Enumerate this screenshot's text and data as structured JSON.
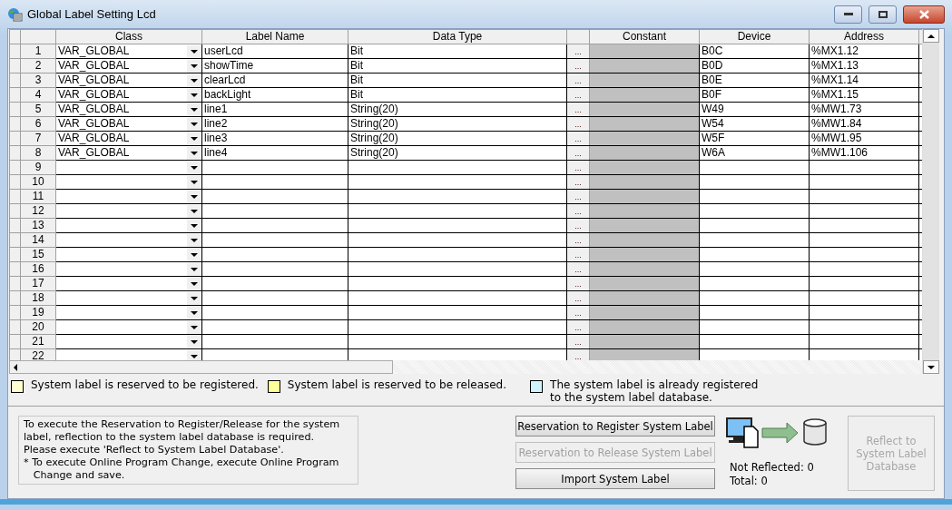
{
  "window": {
    "title": "Global Label Setting Lcd"
  },
  "table": {
    "columns": [
      "Class",
      "Label Name",
      "Data Type",
      "Constant",
      "Device",
      "Address"
    ],
    "rows": [
      {
        "number": "1",
        "class": "VAR_GLOBAL",
        "label_name": "userLcd",
        "data_type": "Bit",
        "browse": "...",
        "device": "B0C",
        "address": "%MX1.12"
      },
      {
        "number": "2",
        "class": "VAR_GLOBAL",
        "label_name": "showTime",
        "data_type": "Bit",
        "browse": "...",
        "device": "B0D",
        "address": "%MX1.13"
      },
      {
        "number": "3",
        "class": "VAR_GLOBAL",
        "label_name": "clearLcd",
        "data_type": "Bit",
        "browse": "...",
        "device": "B0E",
        "address": "%MX1.14"
      },
      {
        "number": "4",
        "class": "VAR_GLOBAL",
        "label_name": "backLight",
        "data_type": "Bit",
        "browse": "...",
        "device": "B0F",
        "address": "%MX1.15"
      },
      {
        "number": "5",
        "class": "VAR_GLOBAL",
        "label_name": "line1",
        "data_type": "String(20)",
        "browse": "...",
        "device": "W49",
        "address": "%MW1.73"
      },
      {
        "number": "6",
        "class": "VAR_GLOBAL",
        "label_name": "line2",
        "data_type": "String(20)",
        "browse": "...",
        "device": "W54",
        "address": "%MW1.84"
      },
      {
        "number": "7",
        "class": "VAR_GLOBAL",
        "label_name": "line3",
        "data_type": "String(20)",
        "browse": "...",
        "device": "W5F",
        "address": "%MW1.95"
      },
      {
        "number": "8",
        "class": "VAR_GLOBAL",
        "label_name": "line4",
        "data_type": "String(20)",
        "browse": "...",
        "device": "W6A",
        "address": "%MW1.106"
      },
      {
        "number": "9",
        "browse": "..."
      },
      {
        "number": "10",
        "browse": "..."
      },
      {
        "number": "11",
        "browse": "..."
      },
      {
        "number": "12",
        "browse": "..."
      },
      {
        "number": "13",
        "browse": "..."
      },
      {
        "number": "14",
        "browse": "..."
      },
      {
        "number": "15",
        "browse": "..."
      },
      {
        "number": "16",
        "browse": "..."
      },
      {
        "number": "17",
        "browse": "..."
      },
      {
        "number": "18",
        "browse": "..."
      },
      {
        "number": "19",
        "browse": "..."
      },
      {
        "number": "20",
        "browse": "..."
      },
      {
        "number": "21",
        "browse": "..."
      },
      {
        "number": "22",
        "browse": "..."
      }
    ]
  },
  "legend": [
    {
      "color": "#ffffd0",
      "text": "System label is reserved to be registered."
    },
    {
      "color": "#ffff99",
      "text": "System label is reserved to be released."
    },
    {
      "color": "#d0f4ff",
      "text": "The system label is already registered\nto the system label database."
    }
  ],
  "info_text": "To execute the Reservation to Register/Release for the system\nlabel, reflection to the system label database is required.\nPlease execute 'Reflect to System Label Database'.\n* To execute Online Program Change, execute Online Program\n   Change and save.",
  "buttons": [
    {
      "label": "Reservation to Register System Label",
      "disabled": false
    },
    {
      "label": "Reservation to Release System Label",
      "disabled": true
    },
    {
      "label": "Import System Label",
      "disabled": false
    }
  ],
  "status": {
    "not_reflected": "Not Reflected: 0",
    "total": "Total: 0"
  },
  "reflect_button": {
    "label": "Reflect to\nSystem Label\nDatabase",
    "disabled": true
  }
}
